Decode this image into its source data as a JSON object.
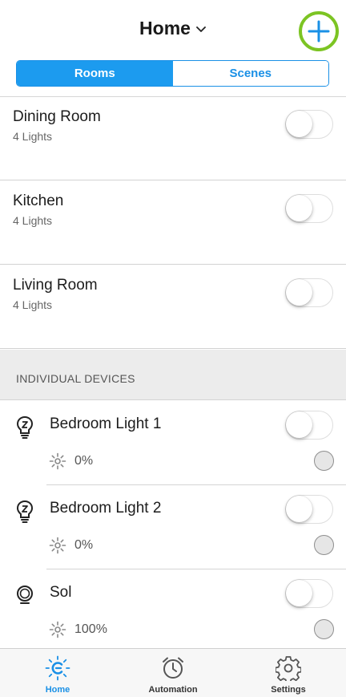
{
  "header": {
    "title": "Home"
  },
  "segment": {
    "items": [
      {
        "label": "Rooms",
        "active": true
      },
      {
        "label": "Scenes",
        "active": false
      }
    ]
  },
  "rooms": [
    {
      "name": "Dining Room",
      "subtitle": "4 Lights",
      "on": false
    },
    {
      "name": "Kitchen",
      "subtitle": "4 Lights",
      "on": false
    },
    {
      "name": "Living Room",
      "subtitle": "4 Lights",
      "on": false
    }
  ],
  "section": {
    "label": "INDIVIDUAL DEVICES"
  },
  "devices": [
    {
      "name": "Bedroom Light 1",
      "brightness": "0%",
      "icon": "zigbee-bulb-icon",
      "on": false
    },
    {
      "name": "Bedroom Light 2",
      "brightness": "0%",
      "icon": "zigbee-bulb-icon",
      "on": false
    },
    {
      "name": "Sol",
      "brightness": "100%",
      "icon": "sol-lamp-icon",
      "on": false
    }
  ],
  "tabbar": {
    "tabs": [
      {
        "label": "Home",
        "icon": "home-c-logo-icon",
        "active": true
      },
      {
        "label": "Automation",
        "icon": "alarm-clock-icon",
        "active": false
      },
      {
        "label": "Settings",
        "icon": "gear-icon",
        "active": false
      }
    ]
  },
  "colors": {
    "accent": "#1c9bef",
    "add_ring": "#7cc423",
    "section_bg": "#ececec"
  }
}
